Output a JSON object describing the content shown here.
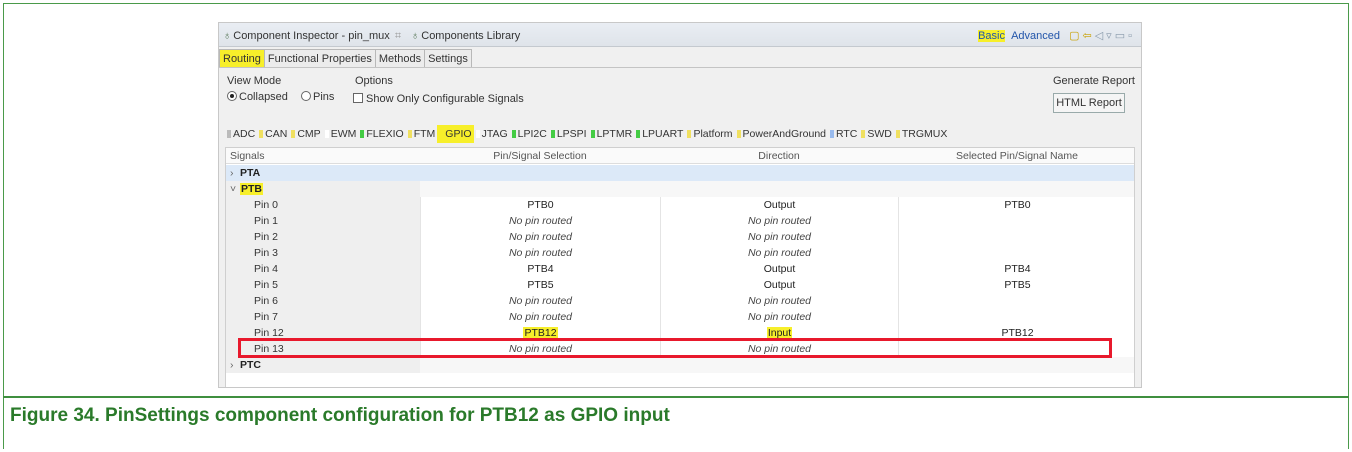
{
  "window": {
    "tabs": [
      "Component Inspector - pin_mux",
      "Components Library"
    ],
    "tab_close_glyph": "⌗",
    "mode_basic": "Basic",
    "mode_advanced": "Advanced"
  },
  "subtabs": [
    "Routing",
    "Functional Properties",
    "Methods",
    "Settings"
  ],
  "view_mode": {
    "label": "View Mode",
    "options": [
      "Collapsed",
      "Pins"
    ],
    "selected": "Collapsed"
  },
  "options": {
    "label": "Options",
    "checkbox_label": "Show Only Configurable Signals",
    "checked": false
  },
  "report": {
    "label": "Generate Report",
    "button": "HTML Report"
  },
  "categories": [
    {
      "label": "ADC",
      "color": "#bbbbbb"
    },
    {
      "label": "CAN",
      "color": "#f0e060"
    },
    {
      "label": "CMP",
      "color": "#f0e060"
    },
    {
      "label": "EWM",
      "color": "#ffffff"
    },
    {
      "label": "FLEXIO",
      "color": "#44cc44"
    },
    {
      "label": "FTM",
      "color": "#f0e060"
    },
    {
      "label": "GPIO",
      "color": "#f7ef2a"
    },
    {
      "label": "JTAG",
      "color": "#ffffff"
    },
    {
      "label": "LPI2C",
      "color": "#44cc44"
    },
    {
      "label": "LPSPI",
      "color": "#44cc44"
    },
    {
      "label": "LPTMR",
      "color": "#44cc44"
    },
    {
      "label": "LPUART",
      "color": "#44cc44"
    },
    {
      "label": "Platform",
      "color": "#f0e060"
    },
    {
      "label": "PowerAndGround",
      "color": "#f0e060"
    },
    {
      "label": "RTC",
      "color": "#99bbee"
    },
    {
      "label": "SWD",
      "color": "#f0e060"
    },
    {
      "label": "TRGMUX",
      "color": "#f0e060"
    }
  ],
  "active_category": "GPIO",
  "table": {
    "headers": [
      "Signals",
      "Pin/Signal Selection",
      "Direction",
      "Selected Pin/Signal Name"
    ],
    "groups": [
      {
        "name": "PTA",
        "expanded": false,
        "selected": true,
        "rows": []
      },
      {
        "name": "PTB",
        "expanded": true,
        "selected": false,
        "highlighted": true,
        "rows": [
          {
            "signal": "Pin 0",
            "selection": "PTB0",
            "direction": "Output",
            "name": "PTB0"
          },
          {
            "signal": "Pin 1",
            "selection": "No pin routed",
            "direction": "No pin routed",
            "name": ""
          },
          {
            "signal": "Pin 2",
            "selection": "No pin routed",
            "direction": "No pin routed",
            "name": ""
          },
          {
            "signal": "Pin 3",
            "selection": "No pin routed",
            "direction": "No pin routed",
            "name": ""
          },
          {
            "signal": "Pin 4",
            "selection": "PTB4",
            "direction": "Output",
            "name": "PTB4"
          },
          {
            "signal": "Pin 5",
            "selection": "PTB5",
            "direction": "Output",
            "name": "PTB5"
          },
          {
            "signal": "Pin 6",
            "selection": "No pin routed",
            "direction": "No pin routed",
            "name": ""
          },
          {
            "signal": "Pin 7",
            "selection": "No pin routed",
            "direction": "No pin routed",
            "name": ""
          },
          {
            "signal": "Pin 12",
            "selection": "PTB12",
            "direction": "Input",
            "name": "PTB12",
            "highlighted": true
          },
          {
            "signal": "Pin 13",
            "selection": "No pin routed",
            "direction": "No pin routed",
            "name": ""
          }
        ]
      },
      {
        "name": "PTC",
        "expanded": false,
        "selected": false,
        "rows": []
      }
    ]
  },
  "caption": "Figure 34.  PinSettings component configuration for PTB12 as GPIO input",
  "colors": {
    "highlight": "#f7ef2a",
    "callout": "#e8192c",
    "caption": "#2a7a2a",
    "selection_row": "#dce9f8"
  }
}
